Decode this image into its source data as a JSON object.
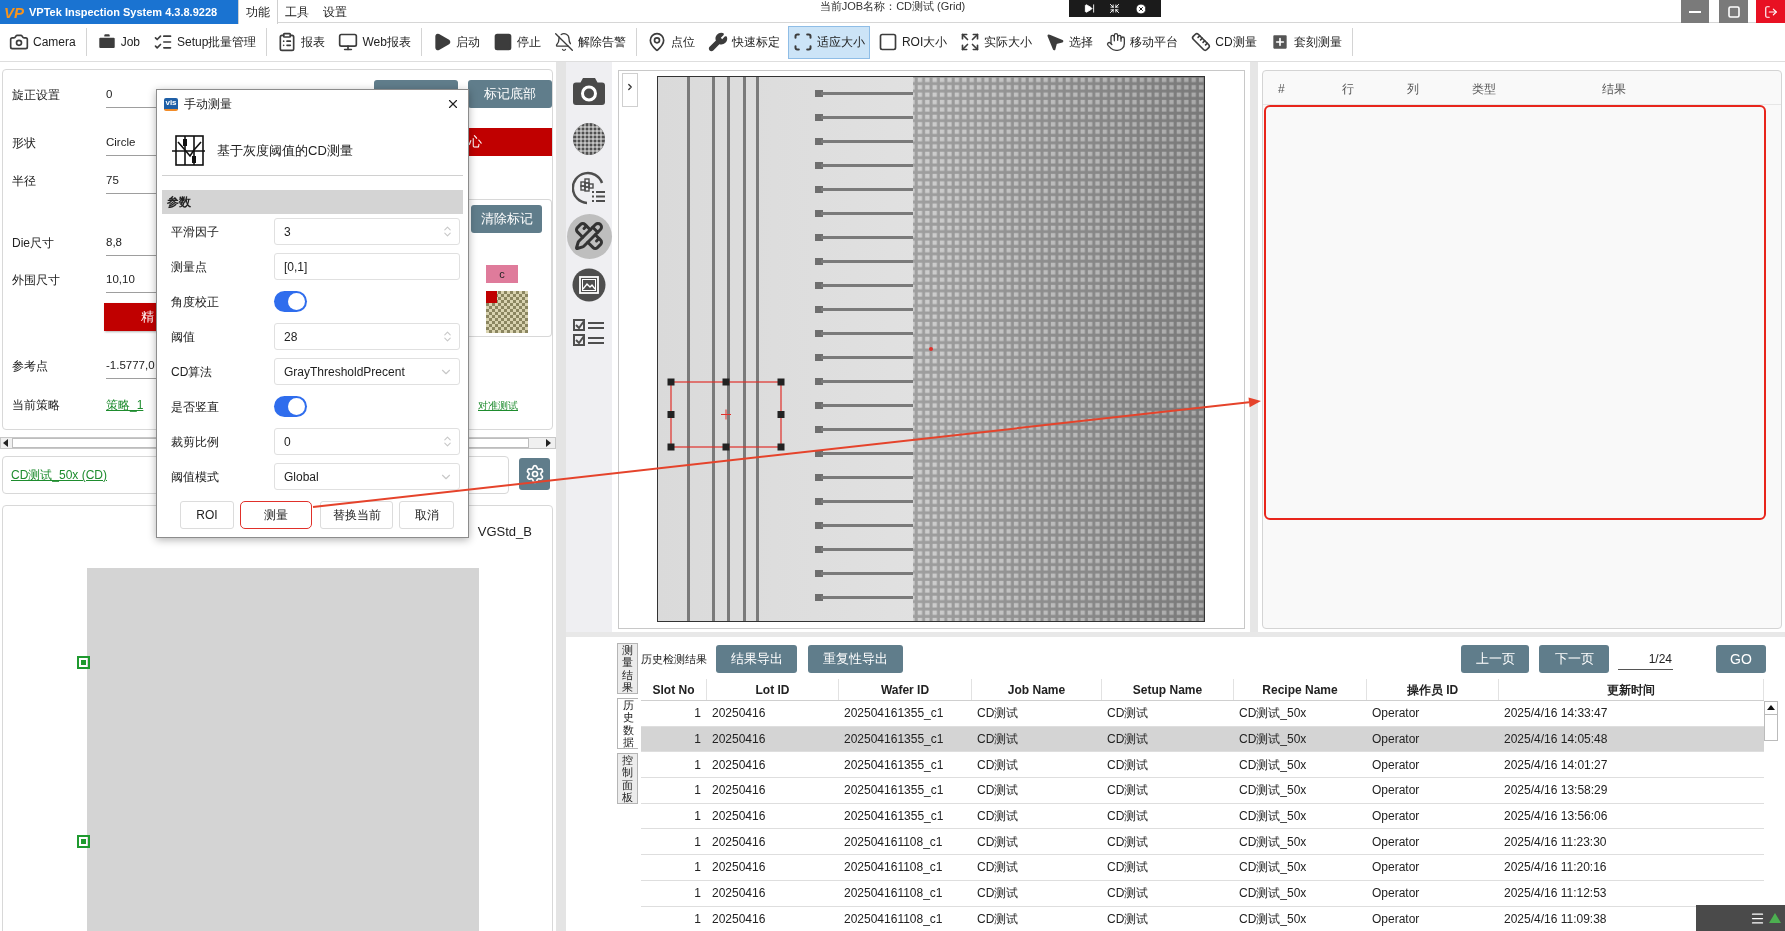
{
  "title_bar": {
    "logo": "VP",
    "app_name": "VPTek Inspection System 4.3.8.9228",
    "menu_tabs": [
      {
        "label": "功能",
        "selected": true
      },
      {
        "label": "工具",
        "selected": false
      },
      {
        "label": "设置",
        "selected": false
      }
    ],
    "job_name": "当前JOB名称：CD测试 (Grid)"
  },
  "toolbar": {
    "groups": [
      {
        "items": [
          {
            "kind": "camera",
            "label": "Camera",
            "selected": false
          }
        ]
      },
      {
        "items": [
          {
            "kind": "job",
            "label": "Job",
            "selected": false
          },
          {
            "kind": "batch",
            "label": "Setup批量管理",
            "selected": false
          }
        ]
      },
      {
        "items": [
          {
            "kind": "report",
            "label": "报表",
            "selected": false
          },
          {
            "kind": "web-report",
            "label": "Web报表",
            "selected": false
          }
        ]
      },
      {
        "items": [
          {
            "kind": "start",
            "label": "启动",
            "selected": false
          },
          {
            "kind": "stop",
            "label": "停止",
            "selected": false
          },
          {
            "kind": "alarm-off",
            "label": "解除告警",
            "selected": false
          }
        ]
      },
      {
        "items": [
          {
            "kind": "point",
            "label": "点位",
            "selected": false
          },
          {
            "kind": "calibrate",
            "label": "快速标定",
            "selected": false
          },
          {
            "kind": "fit",
            "label": "适应大小",
            "selected": true
          },
          {
            "kind": "roi",
            "label": "ROI大小",
            "selected": false
          },
          {
            "kind": "actual-size",
            "label": "实际大小",
            "selected": false
          },
          {
            "kind": "select",
            "label": "选择",
            "selected": false
          },
          {
            "kind": "move",
            "label": "移动平台",
            "selected": false
          },
          {
            "kind": "cd",
            "label": "CD测量",
            "selected": false
          },
          {
            "kind": "overlay",
            "label": "套刻测量",
            "selected": false
          }
        ]
      }
    ]
  },
  "settings_form": {
    "rows": [
      {
        "kind": "field",
        "label": "旋正设置",
        "value": "0"
      },
      {
        "kind": "field",
        "label": "形状",
        "value": "Circle"
      },
      {
        "kind": "field",
        "label": "半径",
        "value": "75"
      },
      {
        "kind": "field",
        "label": "Die尺寸",
        "value": "8,8"
      },
      {
        "kind": "field",
        "label": "外围尺寸",
        "value": "10,10"
      },
      {
        "kind": "button",
        "label": "精"
      },
      {
        "kind": "field",
        "label": "参考点",
        "value": "-1.5777,0"
      },
      {
        "kind": "link",
        "label": "当前策略",
        "value": "策略_1"
      }
    ]
  },
  "side_panel": {
    "buttons": [
      {
        "label": "标记底部",
        "kind": "primary"
      },
      {
        "label": "心",
        "kind": "danger"
      }
    ],
    "clear_button": "清除标记",
    "tag": "c",
    "link": "对准测试"
  },
  "job_link": "CD测试_50x (CD)",
  "layer_label": "VGStd_B",
  "dialog": {
    "icon_label": "vis",
    "title": "手动测量",
    "heading": "基于灰度阈值的CD测量",
    "section": "参数",
    "params": [
      {
        "kind": "spin",
        "label": "平滑因子",
        "value": "3"
      },
      {
        "kind": "text",
        "label": "测量点",
        "value": "[0,1]"
      },
      {
        "kind": "toggle",
        "label": "角度校正",
        "on": true
      },
      {
        "kind": "spin",
        "label": "阈值",
        "value": "28"
      },
      {
        "kind": "select",
        "label": "CD算法",
        "value": "GrayThresholdPrecent"
      },
      {
        "kind": "toggle",
        "label": "是否竖直",
        "on": true
      },
      {
        "kind": "spin",
        "label": "裁剪比例",
        "value": "0"
      },
      {
        "kind": "select",
        "label": "阈值模式",
        "value": "Global"
      }
    ],
    "buttons": [
      {
        "label": "ROI",
        "highlighted": false
      },
      {
        "label": "测量",
        "highlighted": true
      },
      {
        "label": "替换当前",
        "highlighted": false
      },
      {
        "label": "取消",
        "highlighted": false
      }
    ]
  },
  "view_tools": [
    {
      "kind": "camera",
      "selected": false
    },
    {
      "kind": "grid",
      "selected": false
    },
    {
      "kind": "wafer-map",
      "selected": false
    },
    {
      "kind": "ruler",
      "selected": true
    },
    {
      "kind": "image",
      "selected": false
    },
    {
      "kind": "checklist",
      "selected": false
    }
  ],
  "results_panel": {
    "columns": [
      "#",
      "行",
      "列",
      "类型",
      "结果"
    ],
    "highlighted": true
  },
  "history": {
    "tabs": [
      {
        "label": "测量结果",
        "selected": false
      },
      {
        "label": "历史数据",
        "selected": true
      },
      {
        "label": "控制面板",
        "selected": false
      }
    ],
    "title": "历史检测结果",
    "export_buttons": [
      "结果导出",
      "重复性导出"
    ],
    "pager": {
      "prev": "上一页",
      "next": "下一页",
      "page": "1/24",
      "go": "GO"
    },
    "table": {
      "columns": [
        "Slot No",
        "Lot ID",
        "Wafer ID",
        "Job Name",
        "Setup Name",
        "Recipe Name",
        "操作员 ID",
        "更新时间"
      ],
      "rows": [
        {
          "cells": [
            "1",
            "20250416",
            "202504161355_c1",
            "CD测试",
            "CD测试",
            "CD测试_50x",
            "Operator",
            "2025/4/16 14:33:47"
          ],
          "selected": false
        },
        {
          "cells": [
            "1",
            "20250416",
            "202504161355_c1",
            "CD测试",
            "CD测试",
            "CD测试_50x",
            "Operator",
            "2025/4/16 14:05:48"
          ],
          "selected": true
        },
        {
          "cells": [
            "1",
            "20250416",
            "202504161355_c1",
            "CD测试",
            "CD测试",
            "CD测试_50x",
            "Operator",
            "2025/4/16 14:01:27"
          ],
          "selected": false
        },
        {
          "cells": [
            "1",
            "20250416",
            "202504161355_c1",
            "CD测试",
            "CD测试",
            "CD测试_50x",
            "Operator",
            "2025/4/16 13:58:29"
          ],
          "selected": false
        },
        {
          "cells": [
            "1",
            "20250416",
            "202504161355_c1",
            "CD测试",
            "CD测试",
            "CD测试_50x",
            "Operator",
            "2025/4/16 13:56:06"
          ],
          "selected": false
        },
        {
          "cells": [
            "1",
            "20250416",
            "202504161108_c1",
            "CD测试",
            "CD测试",
            "CD测试_50x",
            "Operator",
            "2025/4/16 11:23:30"
          ],
          "selected": false
        },
        {
          "cells": [
            "1",
            "20250416",
            "202504161108_c1",
            "CD测试",
            "CD测试",
            "CD测试_50x",
            "Operator",
            "2025/4/16 11:20:16"
          ],
          "selected": false
        },
        {
          "cells": [
            "1",
            "20250416",
            "202504161108_c1",
            "CD测试",
            "CD测试",
            "CD测试_50x",
            "Operator",
            "2025/4/16 11:12:53"
          ],
          "selected": false
        },
        {
          "cells": [
            "1",
            "20250416",
            "202504161108_c1",
            "CD测试",
            "CD测试",
            "CD测试_50x",
            "Operator",
            "2025/4/16 11:09:38"
          ],
          "selected": false
        }
      ]
    }
  }
}
